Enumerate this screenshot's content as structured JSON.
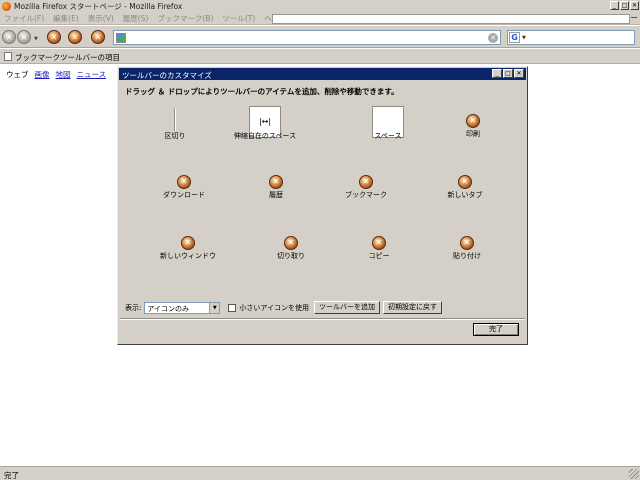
{
  "window": {
    "title": "Mozilla Firefox スタートページ - Mozilla Firefox"
  },
  "menubar": {
    "items": [
      "ファイル(F)",
      "編集(E)",
      "表示(V)",
      "履歴(S)",
      "ブックマーク(B)",
      "ツール(T)",
      "ヘルプ(H)"
    ]
  },
  "bookmarks": {
    "label": "ブックマークツールバーの項目"
  },
  "content": {
    "links": [
      "ウェブ",
      "画像",
      "地図",
      "ニュース"
    ]
  },
  "dialog": {
    "title": "ツールバーのカスタマイズ",
    "instruction": "ドラッグ ＆ ドロップによりツールバーのアイテムを追加、削除や移動できます。",
    "flex_glyph": "|↔|",
    "items": [
      {
        "label": "区切り",
        "icon": "separator"
      },
      {
        "label": "伸縮自在のスペース",
        "icon": "flexible-space"
      },
      {
        "label": "スペース",
        "icon": "space"
      },
      {
        "label": "印刷",
        "icon": "x"
      },
      {
        "label": "ダウンロード",
        "icon": "x"
      },
      {
        "label": "履歴",
        "icon": "x"
      },
      {
        "label": "ブックマーク",
        "icon": "x"
      },
      {
        "label": "新しいタブ",
        "icon": "x"
      },
      {
        "label": "新しいウィンドウ",
        "icon": "x"
      },
      {
        "label": "切り取り",
        "icon": "x"
      },
      {
        "label": "コピー",
        "icon": "x"
      },
      {
        "label": "貼り付け",
        "icon": "x"
      }
    ],
    "show_label": "表示:",
    "show_value": "アイコンのみ",
    "small_icons_label": "小さいアイコンを使用",
    "add_toolbar_label": "ツールバーを追加",
    "restore_label": "初期設定に戻す",
    "done_label": "完了"
  },
  "status": {
    "text": "完了"
  },
  "colors": {
    "dialog_title_bg": "#0a246a",
    "chrome_bg": "#d4d0c8",
    "link": "#1a1ab8"
  }
}
